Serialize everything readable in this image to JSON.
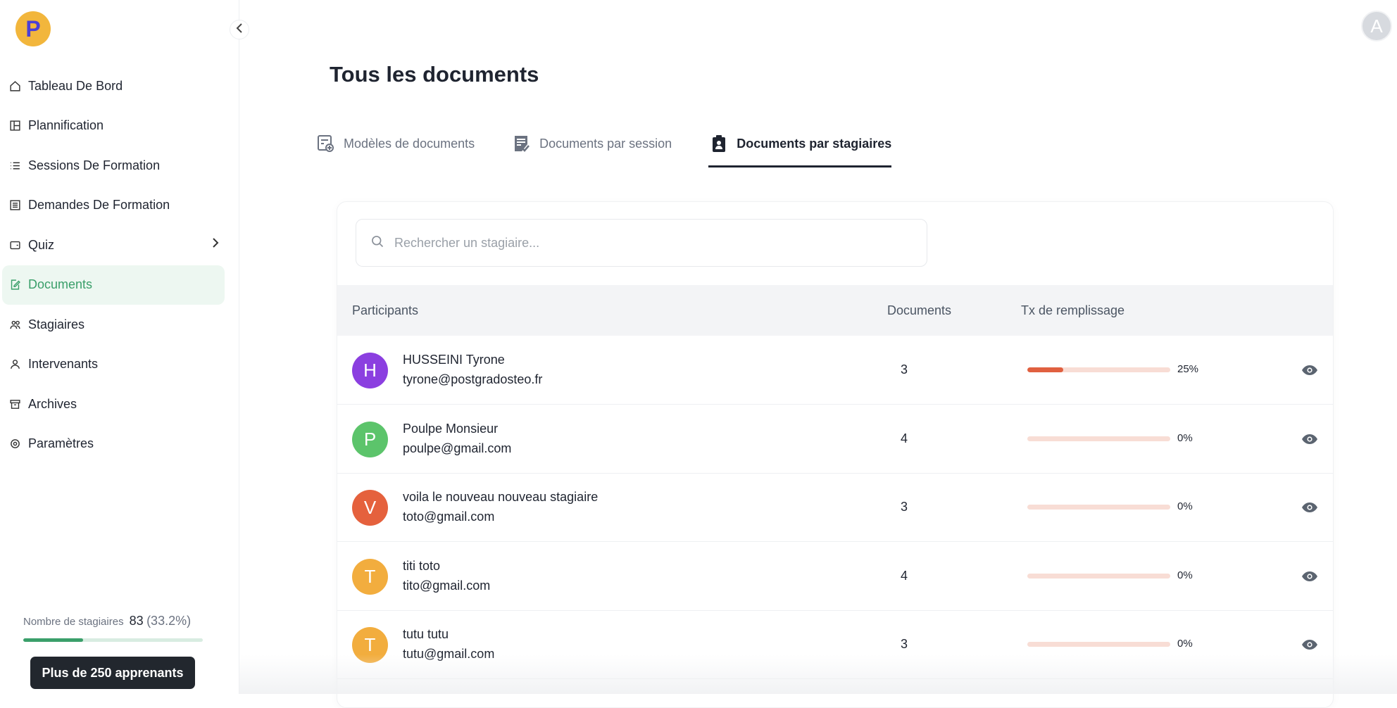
{
  "logo": {
    "letter": "P"
  },
  "user": {
    "avatar_letter": "A"
  },
  "sidebar": {
    "items": [
      {
        "label": "Tableau De Bord",
        "icon": "home-icon"
      },
      {
        "label": "Plannification",
        "icon": "layout-icon"
      },
      {
        "label": "Sessions De Formation",
        "icon": "list-icon"
      },
      {
        "label": "Demandes De Formation",
        "icon": "form-icon"
      },
      {
        "label": "Quiz",
        "icon": "quiz-icon"
      },
      {
        "label": "Documents",
        "icon": "document-edit-icon"
      },
      {
        "label": "Stagiaires",
        "icon": "users-icon"
      },
      {
        "label": "Intervenants",
        "icon": "user-icon"
      },
      {
        "label": "Archives",
        "icon": "archive-icon"
      },
      {
        "label": "Paramètres",
        "icon": "gear-icon"
      }
    ],
    "active_index": 5,
    "quota": {
      "label": "Nombre de stagiaires",
      "value": "83",
      "percent_text": "(33.2%)",
      "fraction": 0.332
    },
    "upgrade_label": "Plus de 250 apprenants"
  },
  "main": {
    "title": "Tous les documents",
    "tabs": [
      {
        "label": "Modèles de documents",
        "icon": "template-icon"
      },
      {
        "label": "Documents par session",
        "icon": "doc-check-icon"
      },
      {
        "label": "Documents par stagiaires",
        "icon": "clipboard-user-icon"
      }
    ],
    "active_tab": 2,
    "search": {
      "placeholder": "Rechercher un stagiaire..."
    },
    "table": {
      "headers": {
        "participants": "Participants",
        "documents": "Documents",
        "rate": "Tx de remplissage"
      },
      "rows": [
        {
          "initial": "H",
          "color": "#8b3fe0",
          "name": "HUSSEINI Tyrone",
          "email": "tyrone@postgradosteo.fr",
          "documents": "3",
          "rate_text": "25%",
          "rate": 0.25
        },
        {
          "initial": "P",
          "color": "#5cc46b",
          "name": "Poulpe Monsieur",
          "email": "poulpe@gmail.com",
          "documents": "4",
          "rate_text": "0%",
          "rate": 0
        },
        {
          "initial": "V",
          "color": "#e5613d",
          "name": "voila le nouveau nouveau stagiaire",
          "email": "toto@gmail.com",
          "documents": "3",
          "rate_text": "0%",
          "rate": 0
        },
        {
          "initial": "T",
          "color": "#f2ad3e",
          "name": "titi toto",
          "email": "tito@gmail.com",
          "documents": "4",
          "rate_text": "0%",
          "rate": 0
        },
        {
          "initial": "T",
          "color": "#f2ad3e",
          "name": "tutu tutu",
          "email": "tutu@gmail.com",
          "documents": "3",
          "rate_text": "0%",
          "rate": 0
        }
      ]
    }
  },
  "colors": {
    "accent_green": "#3a9f6a",
    "progress_red": "#e06040",
    "progress_track": "#f8ddd5"
  }
}
